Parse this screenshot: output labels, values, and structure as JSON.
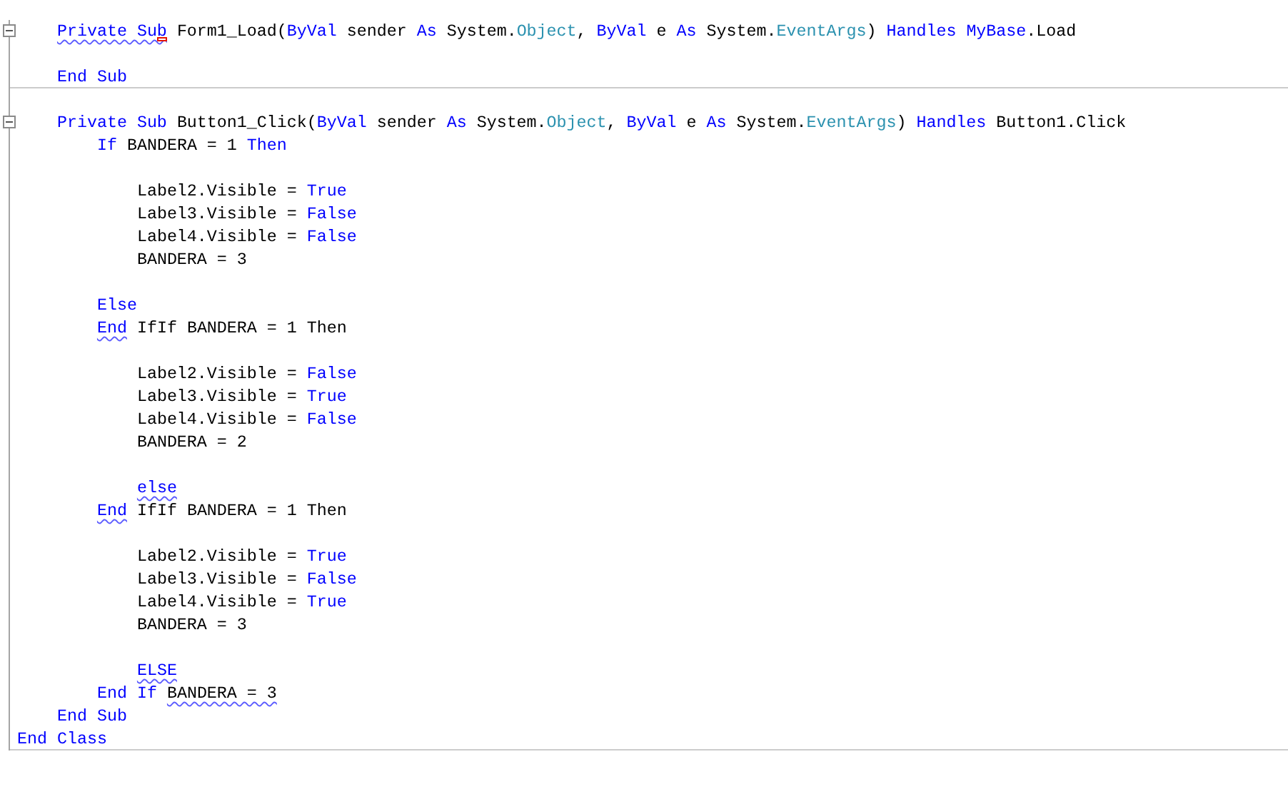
{
  "editor": {
    "lines": [
      {
        "gap_before": true,
        "collapse": true,
        "tokens": [
          {
            "text": "    Private Sub",
            "kind": "keyword",
            "squiggle": true,
            "smart_tag": true
          },
          {
            "text": " Form1_Load(",
            "kind": "plain"
          },
          {
            "text": "ByVal",
            "kind": "keyword"
          },
          {
            "text": " sender ",
            "kind": "plain"
          },
          {
            "text": "As",
            "kind": "keyword"
          },
          {
            "text": " System.",
            "kind": "plain"
          },
          {
            "text": "Object",
            "kind": "type"
          },
          {
            "text": ", ",
            "kind": "plain"
          },
          {
            "text": "ByVal",
            "kind": "keyword"
          },
          {
            "text": " e ",
            "kind": "plain"
          },
          {
            "text": "As",
            "kind": "keyword"
          },
          {
            "text": " System.",
            "kind": "plain"
          },
          {
            "text": "EventArgs",
            "kind": "type"
          },
          {
            "text": ") ",
            "kind": "plain"
          },
          {
            "text": "Handles",
            "kind": "keyword"
          },
          {
            "text": " MyBase",
            "kind": "keyword"
          },
          {
            "text": ".Load",
            "kind": "plain"
          }
        ]
      },
      {
        "gap_before": true,
        "divider": true,
        "tokens": [
          {
            "text": "    End Sub",
            "kind": "keyword"
          }
        ]
      },
      {
        "gap_before": true,
        "collapse": true,
        "tokens": [
          {
            "text": "    Private Sub",
            "kind": "keyword"
          },
          {
            "text": " Button1_Click(",
            "kind": "plain"
          },
          {
            "text": "ByVal",
            "kind": "keyword"
          },
          {
            "text": " sender ",
            "kind": "plain"
          },
          {
            "text": "As",
            "kind": "keyword"
          },
          {
            "text": " System.",
            "kind": "plain"
          },
          {
            "text": "Object",
            "kind": "type"
          },
          {
            "text": ", ",
            "kind": "plain"
          },
          {
            "text": "ByVal",
            "kind": "keyword"
          },
          {
            "text": " e ",
            "kind": "plain"
          },
          {
            "text": "As",
            "kind": "keyword"
          },
          {
            "text": " System.",
            "kind": "plain"
          },
          {
            "text": "EventArgs",
            "kind": "type"
          },
          {
            "text": ") ",
            "kind": "plain"
          },
          {
            "text": "Handles",
            "kind": "keyword"
          },
          {
            "text": " Button1.Click",
            "kind": "plain"
          }
        ]
      },
      {
        "tokens": [
          {
            "text": "        If",
            "kind": "keyword"
          },
          {
            "text": " BANDERA = 1 ",
            "kind": "plain"
          },
          {
            "text": "Then",
            "kind": "keyword"
          }
        ]
      },
      {
        "gap_before": true,
        "tokens": [
          {
            "text": "            Label2.Visible = ",
            "kind": "plain"
          },
          {
            "text": "True",
            "kind": "keyword"
          }
        ]
      },
      {
        "tokens": [
          {
            "text": "            Label3.Visible = ",
            "kind": "plain"
          },
          {
            "text": "False",
            "kind": "keyword"
          }
        ]
      },
      {
        "tokens": [
          {
            "text": "            Label4.Visible = ",
            "kind": "plain"
          },
          {
            "text": "False",
            "kind": "keyword"
          }
        ]
      },
      {
        "tokens": [
          {
            "text": "            BANDERA = 3",
            "kind": "plain"
          }
        ]
      },
      {
        "gap_before": true,
        "tokens": [
          {
            "text": "        Else",
            "kind": "keyword"
          }
        ]
      },
      {
        "tokens": [
          {
            "text": "        End",
            "kind": "keyword",
            "squiggle": true
          },
          {
            "text": " IfIf BANDERA = 1 Then",
            "kind": "plain"
          }
        ]
      },
      {
        "gap_before": true,
        "tokens": [
          {
            "text": "            Label2.Visible = ",
            "kind": "plain"
          },
          {
            "text": "False",
            "kind": "keyword"
          }
        ]
      },
      {
        "tokens": [
          {
            "text": "            Label3.Visible = ",
            "kind": "plain"
          },
          {
            "text": "True",
            "kind": "keyword"
          }
        ]
      },
      {
        "tokens": [
          {
            "text": "            Label4.Visible = ",
            "kind": "plain"
          },
          {
            "text": "False",
            "kind": "keyword"
          }
        ]
      },
      {
        "tokens": [
          {
            "text": "            BANDERA = 2",
            "kind": "plain"
          }
        ]
      },
      {
        "gap_before": true,
        "tokens": [
          {
            "text": "            else",
            "kind": "keyword",
            "squiggle": true
          }
        ]
      },
      {
        "tokens": [
          {
            "text": "        End",
            "kind": "keyword",
            "squiggle": true
          },
          {
            "text": " IfIf BANDERA = 1 Then",
            "kind": "plain"
          }
        ]
      },
      {
        "gap_before": true,
        "tokens": [
          {
            "text": "            Label2.Visible = ",
            "kind": "plain"
          },
          {
            "text": "True",
            "kind": "keyword"
          }
        ]
      },
      {
        "tokens": [
          {
            "text": "            Label3.Visible = ",
            "kind": "plain"
          },
          {
            "text": "False",
            "kind": "keyword"
          }
        ]
      },
      {
        "tokens": [
          {
            "text": "            Label4.Visible = ",
            "kind": "plain"
          },
          {
            "text": "True",
            "kind": "keyword"
          }
        ]
      },
      {
        "tokens": [
          {
            "text": "            BANDERA = 3",
            "kind": "plain"
          }
        ]
      },
      {
        "gap_before": true,
        "tokens": [
          {
            "text": "            ELSE",
            "kind": "keyword",
            "squiggle": true
          }
        ]
      },
      {
        "tokens": [
          {
            "text": "        End If",
            "kind": "keyword"
          },
          {
            "text": " BANDERA = 3",
            "kind": "plain",
            "squiggle": true
          }
        ]
      },
      {
        "tokens": [
          {
            "text": "    End Sub",
            "kind": "keyword"
          }
        ]
      },
      {
        "divider": true,
        "tokens": [
          {
            "text": "End Class",
            "kind": "keyword"
          }
        ]
      }
    ]
  }
}
